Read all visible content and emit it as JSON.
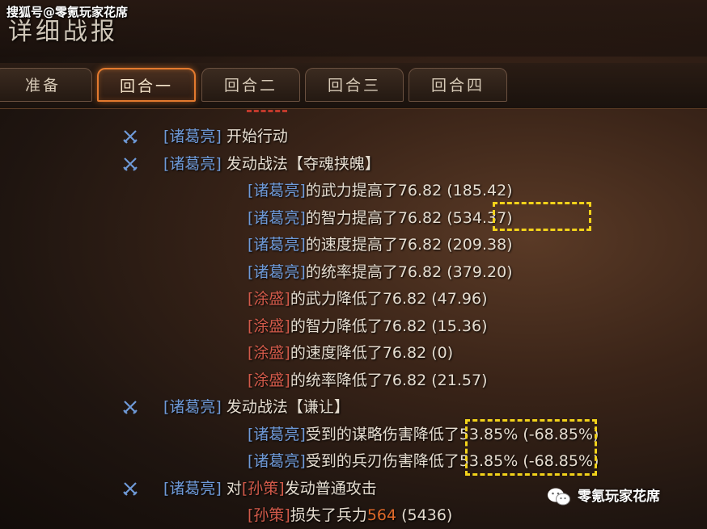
{
  "watermark_top": "搜狐号@零氪玩家花席",
  "watermark_bottom": "零氪玩家花席",
  "title": "详细战报",
  "tabs": [
    {
      "label": "准备",
      "active": false
    },
    {
      "label": "回合一",
      "active": true
    },
    {
      "label": "回合二",
      "active": false
    },
    {
      "label": "回合三",
      "active": false
    },
    {
      "label": "回合四",
      "active": false
    }
  ],
  "log": [
    {
      "icon": "crossed-swords-icon",
      "parts": [
        {
          "t": "[诸葛亮]",
          "c": "blue"
        },
        {
          "t": " 开始行动",
          "c": ""
        }
      ]
    },
    {
      "icon": "crossed-swords-icon",
      "parts": [
        {
          "t": "[诸葛亮]",
          "c": "blue"
        },
        {
          "t": " 发动战法【夺魂挟魄】",
          "c": ""
        }
      ]
    },
    {
      "parts": [
        {
          "t": "[诸葛亮]",
          "c": "blue"
        },
        {
          "t": "的武力提高了76.82 (185.42)",
          "c": ""
        }
      ]
    },
    {
      "parts": [
        {
          "t": "[诸葛亮]",
          "c": "blue"
        },
        {
          "t": "的智力提高了76.82 (534.37)",
          "c": ""
        }
      ]
    },
    {
      "parts": [
        {
          "t": "[诸葛亮]",
          "c": "blue"
        },
        {
          "t": "的速度提高了76.82 (209.38)",
          "c": ""
        }
      ]
    },
    {
      "parts": [
        {
          "t": "[诸葛亮]",
          "c": "blue"
        },
        {
          "t": "的统率提高了76.82 (379.20)",
          "c": ""
        }
      ]
    },
    {
      "parts": [
        {
          "t": "[涂盛]",
          "c": "red"
        },
        {
          "t": "的武力降低了76.82 (47.96)",
          "c": ""
        }
      ]
    },
    {
      "parts": [
        {
          "t": "[涂盛]",
          "c": "red"
        },
        {
          "t": "的智力降低了76.82 (15.36)",
          "c": ""
        }
      ]
    },
    {
      "parts": [
        {
          "t": "[涂盛]",
          "c": "red"
        },
        {
          "t": "的速度降低了76.82 (0)",
          "c": ""
        }
      ]
    },
    {
      "parts": [
        {
          "t": "[涂盛]",
          "c": "red"
        },
        {
          "t": "的统率降低了76.82 (21.57)",
          "c": ""
        }
      ]
    },
    {
      "icon": "crossed-swords-icon",
      "parts": [
        {
          "t": "[诸葛亮]",
          "c": "blue"
        },
        {
          "t": " 发动战法【谦让】",
          "c": ""
        }
      ]
    },
    {
      "parts": [
        {
          "t": "[诸葛亮]",
          "c": "blue"
        },
        {
          "t": "受到的谋略伤害降低了53.85% (-68.85%)",
          "c": ""
        }
      ]
    },
    {
      "parts": [
        {
          "t": "[诸葛亮]",
          "c": "blue"
        },
        {
          "t": "受到的兵刃伤害降低了53.85% (-68.85%)",
          "c": ""
        }
      ]
    },
    {
      "icon": "crossed-swords-icon",
      "parts": [
        {
          "t": "[诸葛亮]",
          "c": "blue"
        },
        {
          "t": " 对",
          "c": ""
        },
        {
          "t": "[孙策]",
          "c": "red"
        },
        {
          "t": "发动普通攻击",
          "c": ""
        }
      ]
    },
    {
      "parts": [
        {
          "t": "[孙策]",
          "c": "red"
        },
        {
          "t": "损失了兵力",
          "c": ""
        },
        {
          "t": "564",
          "c": "orange"
        },
        {
          "t": " (5436)",
          "c": ""
        }
      ]
    }
  ],
  "colors": {
    "ally": "#6f9ad8",
    "enemy": "#d25a4a",
    "damage": "#e06a2a",
    "highlight": "#f2d21a",
    "active_tab": "#e47a2e"
  }
}
